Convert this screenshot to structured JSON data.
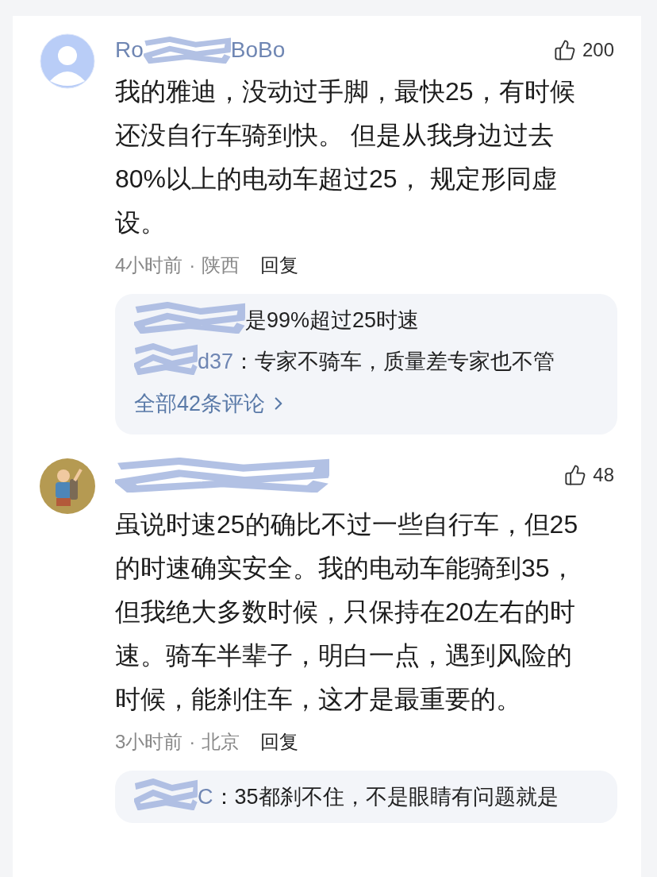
{
  "comments": [
    {
      "avatar": {
        "kind": "default"
      },
      "name_parts": [
        "Ro",
        "BoBo"
      ],
      "likes": "200",
      "body": "我的雅迪，没动过手脚，最快25，有时候还没自行车骑到快。 但是从我身边过去80%以上的电动车超过25， 规定形同虚设。",
      "time": "4小时前",
      "separator": "·",
      "location": "陕西",
      "reply_label": "回复",
      "replies": [
        {
          "text": "是99%超过25时速"
        },
        {
          "author_part": "d37",
          "text": "：专家不骑车，质量差专家也不管"
        }
      ],
      "more": "全部42条评论"
    },
    {
      "avatar": {
        "kind": "picture"
      },
      "likes": "48",
      "body": "虽说时速25的确比不过一些自行车，但25的时速确实安全。我的电动车能骑到35，但我绝大多数时候，只保持在20左右的时速。骑车半辈子，明白一点，遇到风险的时候，能刹住车，这才是最重要的。",
      "time": "3小时前",
      "separator": "·",
      "location": "北京",
      "reply_label": "回复",
      "replies": [
        {
          "author_part": "C",
          "text": "：35都刹不住，不是眼睛有问题就是"
        }
      ]
    }
  ]
}
